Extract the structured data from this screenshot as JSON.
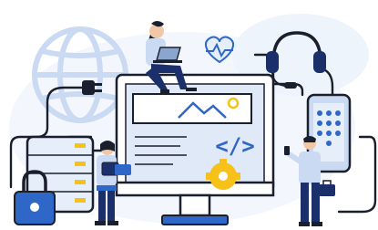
{
  "illustration": {
    "colors": {
      "navy": "#1b2f6b",
      "blue": "#2e67c8",
      "light_blue": "#c9daf2",
      "pale_blue": "#e6eef9",
      "yellow": "#f6c21a",
      "skin": "#f0c8a8",
      "dark": "#1a1f2e",
      "white": "#ffffff"
    },
    "code_symbol": "</>",
    "icons": [
      "globe-icon",
      "power-plug-icon",
      "heart-pulse-icon",
      "headset-icon",
      "server-rack-icon",
      "padlock-icon",
      "smartphone-icon",
      "computer-monitor-icon",
      "image-placeholder-icon",
      "gear-icon",
      "laptop-icon"
    ]
  }
}
